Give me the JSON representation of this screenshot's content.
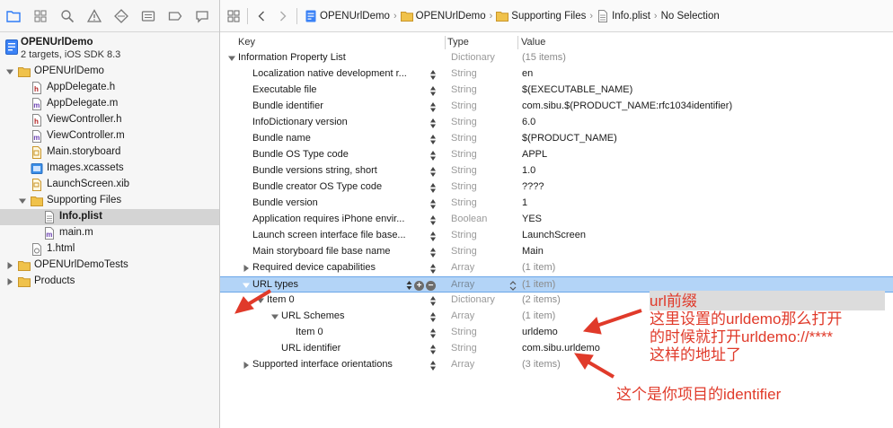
{
  "navigator": {
    "project_title": "OPENUrlDemo",
    "project_subtitle": "2 targets, iOS SDK 8.3",
    "items": [
      {
        "label": "OPENUrlDemo",
        "icon": "folder-icon",
        "disclosure": "open",
        "selected": false
      },
      {
        "label": "AppDelegate.h",
        "icon": "header-file-icon",
        "disclosure": "none",
        "selected": false
      },
      {
        "label": "AppDelegate.m",
        "icon": "source-file-icon",
        "disclosure": "none",
        "selected": false
      },
      {
        "label": "ViewController.h",
        "icon": "header-file-icon",
        "disclosure": "none",
        "selected": false
      },
      {
        "label": "ViewController.m",
        "icon": "source-file-icon",
        "disclosure": "none",
        "selected": false
      },
      {
        "label": "Main.storyboard",
        "icon": "storyboard-icon",
        "disclosure": "none",
        "selected": false
      },
      {
        "label": "Images.xcassets",
        "icon": "asset-catalog-icon",
        "disclosure": "none",
        "selected": false
      },
      {
        "label": "LaunchScreen.xib",
        "icon": "xib-file-icon",
        "disclosure": "none",
        "selected": false
      },
      {
        "label": "Supporting Files",
        "icon": "folder-icon",
        "disclosure": "open",
        "selected": false
      },
      {
        "label": "Info.plist",
        "icon": "plist-file-icon",
        "disclosure": "none",
        "selected": true
      },
      {
        "label": "main.m",
        "icon": "source-file-icon",
        "disclosure": "none",
        "selected": false
      },
      {
        "label": "1.html",
        "icon": "html-file-icon",
        "disclosure": "none",
        "selected": false
      },
      {
        "label": "OPENUrlDemoTests",
        "icon": "folder-icon",
        "disclosure": "closed",
        "selected": false
      },
      {
        "label": "Products",
        "icon": "folder-icon",
        "disclosure": "closed",
        "selected": false
      }
    ]
  },
  "jumpbar": {
    "crumbs": [
      "OPENUrlDemo",
      "OPENUrlDemo",
      "Supporting Files",
      "Info.plist",
      "No Selection"
    ]
  },
  "columns": {
    "key": "Key",
    "type": "Type",
    "value": "Value"
  },
  "plist_rows": [
    {
      "key": "Information Property List",
      "type": "Dictionary",
      "value": "(15 items)",
      "disclosure": "open"
    },
    {
      "key": "Localization native development r...",
      "type": "String",
      "value": "en"
    },
    {
      "key": "Executable file",
      "type": "String",
      "value": "$(EXECUTABLE_NAME)"
    },
    {
      "key": "Bundle identifier",
      "type": "String",
      "value": "com.sibu.$(PRODUCT_NAME:rfc1034identifier)"
    },
    {
      "key": "InfoDictionary version",
      "type": "String",
      "value": "6.0"
    },
    {
      "key": "Bundle name",
      "type": "String",
      "value": "$(PRODUCT_NAME)"
    },
    {
      "key": "Bundle OS Type code",
      "type": "String",
      "value": "APPL"
    },
    {
      "key": "Bundle versions string, short",
      "type": "String",
      "value": "1.0"
    },
    {
      "key": "Bundle creator OS Type code",
      "type": "String",
      "value": "????"
    },
    {
      "key": "Bundle version",
      "type": "String",
      "value": "1"
    },
    {
      "key": "Application requires iPhone envir...",
      "type": "Boolean",
      "value": "YES"
    },
    {
      "key": "Launch screen interface file base...",
      "type": "String",
      "value": "LaunchScreen"
    },
    {
      "key": "Main storyboard file base name",
      "type": "String",
      "value": "Main"
    },
    {
      "key": "Required device capabilities",
      "type": "Array",
      "value": "(1 item)",
      "disclosure": "closed"
    },
    {
      "key": "URL types",
      "type": "Array",
      "value": "(1 item)",
      "disclosure": "open",
      "selected": true
    },
    {
      "key": "Item 0",
      "type": "Dictionary",
      "value": "(2 items)",
      "disclosure": "open"
    },
    {
      "key": "URL Schemes",
      "type": "Array",
      "value": "(1 item)",
      "disclosure": "open"
    },
    {
      "key": "Item 0",
      "type": "String",
      "value": "urldemo"
    },
    {
      "key": "URL identifier",
      "type": "String",
      "value": "com.sibu.urldemo"
    },
    {
      "key": "Supported interface orientations",
      "type": "Array",
      "value": "(3 items)",
      "disclosure": "closed"
    }
  ],
  "annotations": {
    "note1_line1": "url前缀",
    "note1_line2": "这里设置的urldemo那么打开",
    "note1_line3": "的时候就打开urldemo://****",
    "note1_line4": "这样的地址了",
    "note2": "这个是你项目的identifier",
    "color": "#e03a2a"
  }
}
